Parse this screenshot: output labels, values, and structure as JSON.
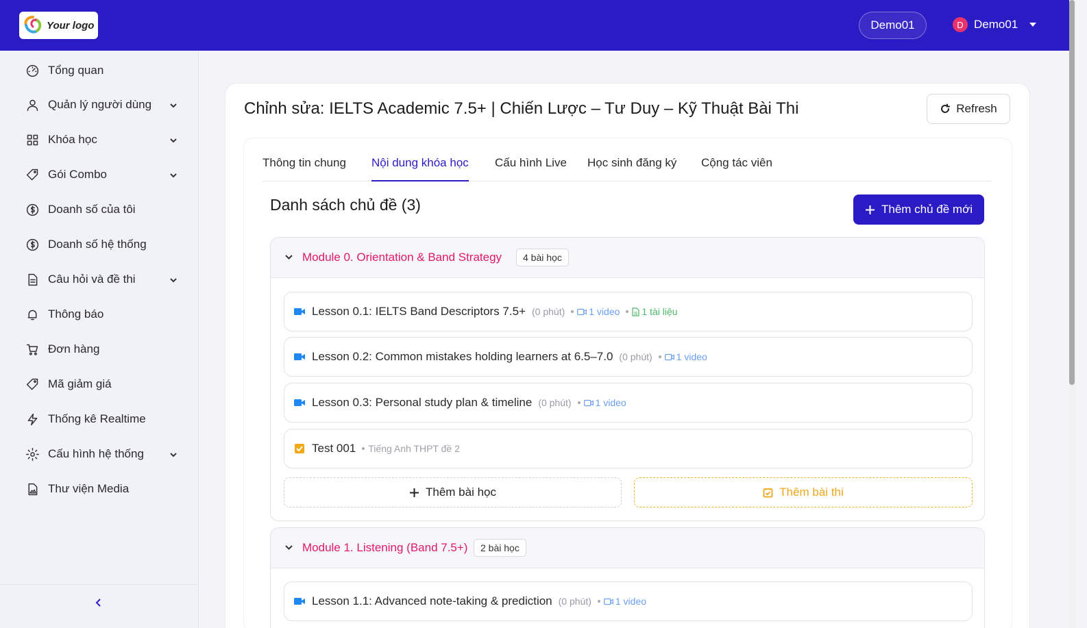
{
  "header": {
    "logo_text": "Your logo",
    "demo_pill": "Demo01",
    "user": {
      "avatar_initial": "D",
      "name": "Demo01"
    }
  },
  "sidebar": {
    "items": [
      {
        "label": "Tổng quan",
        "icon": "dashboard-icon",
        "expandable": false
      },
      {
        "label": "Quản lý người dùng",
        "icon": "user-icon",
        "expandable": true
      },
      {
        "label": "Khóa học",
        "icon": "grid-icon",
        "expandable": true
      },
      {
        "label": "Gói Combo",
        "icon": "tag-icon",
        "expandable": true
      },
      {
        "label": "Doanh số của tôi",
        "icon": "dollar-circle-icon",
        "expandable": false
      },
      {
        "label": "Doanh số hệ thống",
        "icon": "dollar-circle-icon",
        "expandable": false
      },
      {
        "label": "Câu hỏi và đề thi",
        "icon": "document-icon",
        "expandable": true
      },
      {
        "label": "Thông báo",
        "icon": "bell-icon",
        "expandable": false
      },
      {
        "label": "Đơn hàng",
        "icon": "cart-icon",
        "expandable": false
      },
      {
        "label": "Mã giảm giá",
        "icon": "tag-icon",
        "expandable": false
      },
      {
        "label": "Thống kê Realtime",
        "icon": "lightning-icon",
        "expandable": false
      },
      {
        "label": "Cấu hình hệ thống",
        "icon": "gear-icon",
        "expandable": true
      },
      {
        "label": "Thư viện Media",
        "icon": "media-file-icon",
        "expandable": false
      }
    ]
  },
  "page": {
    "title": "Chỉnh sửa: IELTS Academic 7.5+ | Chiến Lược – Tư Duy – Kỹ Thuật Bài Thi",
    "refresh_label": "Refresh"
  },
  "tabs": [
    {
      "label": "Thông tin chung",
      "active": false
    },
    {
      "label": "Nội dung khóa học",
      "active": true
    },
    {
      "label": "Cấu hình Live",
      "active": false
    },
    {
      "label": "Học sinh đăng ký",
      "active": false
    },
    {
      "label": "Cộng tác viên",
      "active": false
    }
  ],
  "content": {
    "section_title": "Danh sách chủ đề (3)",
    "add_topic_label": "Thêm chủ đề mới",
    "add_lesson_label": "Thêm bài học",
    "add_test_label": "Thêm bài thi",
    "modules": [
      {
        "title": "Module 0. Orientation & Band Strategy",
        "badge": "4 bài học",
        "lessons": [
          {
            "type": "video",
            "title": "Lesson 0.1: IELTS Band Descriptors 7.5+",
            "duration": "(0 phút)",
            "video": "1 video",
            "doc": "1 tài liệu"
          },
          {
            "type": "video",
            "title": "Lesson 0.2: Common mistakes holding learners at 6.5–7.0",
            "duration": "(0 phút)",
            "video": "1 video"
          },
          {
            "type": "video",
            "title": "Lesson 0.3: Personal study plan & timeline",
            "duration": "(0 phút)",
            "video": "1 video"
          },
          {
            "type": "test",
            "title": "Test 001",
            "note": "Tiếng Anh THPT đề 2"
          }
        ]
      },
      {
        "title": "Module 1. Listening (Band 7.5+)",
        "badge": "2 bài học",
        "lessons": [
          {
            "type": "video",
            "title": "Lesson 1.1: Advanced note-taking & prediction",
            "duration": "(0 phút)",
            "video": "1 video"
          }
        ]
      }
    ]
  },
  "colors": {
    "primary": "#2b1bc4",
    "module_title": "#e0186b",
    "test_accent": "#f0a81c",
    "video_meta": "#6a9ef0",
    "doc_meta": "#4cb86a"
  }
}
